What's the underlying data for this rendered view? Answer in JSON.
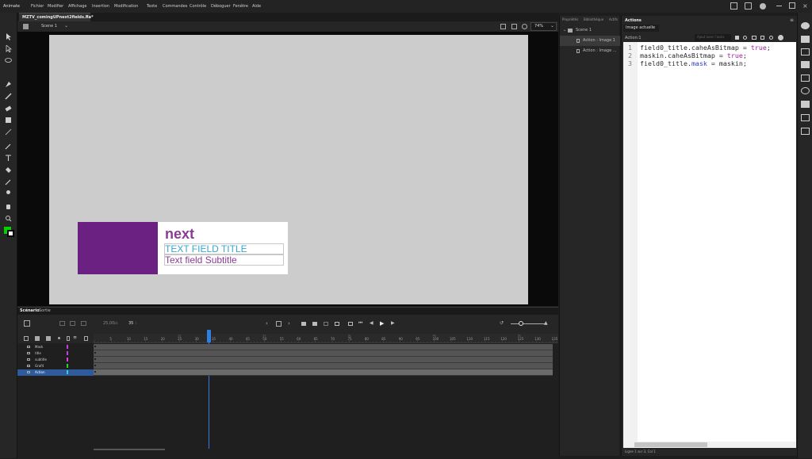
{
  "app": {
    "name": "Animate"
  },
  "menu": [
    "Fichier",
    "Modifier",
    "Affichage",
    "Insertion",
    "Modification",
    "Texte",
    "Commandes",
    "Contrôle",
    "Déboguer",
    "Fenêtre",
    "Aide"
  ],
  "document": {
    "tab": "MZTV_comingUPnext2fields.fla*",
    "scene": "Scene 1",
    "zoom": "74%"
  },
  "stage": {
    "banner_next": "next",
    "banner_title": "TEXT FIELD TITLE",
    "banner_subtitle": "Text field Subtitle"
  },
  "timeline": {
    "tabs": [
      "Scénario",
      "Sortie"
    ],
    "fps": "25,00",
    "fps_unit": "i/s",
    "frame": "35",
    "frame_unit": "i",
    "layers": [
      "Mask",
      "title",
      "subtitle",
      "Graf4",
      "Action"
    ],
    "ruler_numbers": [
      "5",
      "10",
      "15",
      "20",
      "25",
      "30",
      "35",
      "40",
      "45",
      "50",
      "55",
      "60",
      "65",
      "70",
      "75",
      "80",
      "85",
      "90",
      "95",
      "100",
      "105",
      "110",
      "115",
      "120",
      "125",
      "130",
      "135"
    ],
    "ruler_seconds": [
      "1s",
      "2s",
      "3s",
      "4s",
      "5s"
    ]
  },
  "scene_panel": {
    "tabs": [
      "Propriétés",
      "Bibliothèque",
      "Actifs"
    ],
    "root": "Scene 1",
    "items": [
      "Action : Image 1",
      "Action : Image ..."
    ]
  },
  "actions_panel": {
    "title": "Actions",
    "current_image_btn": "Image actuelle",
    "breadcrumb": "Action:1",
    "search_placeholder": "Ajout avec l'assis",
    "code_lines": [
      [
        "field0_title.caheAsBitmap = ",
        "true",
        ";"
      ],
      [
        "maskin.caheAsBitmap = ",
        "true",
        ";"
      ],
      [
        "field0_title.",
        "mask",
        " = maskin;"
      ]
    ],
    "status": "Ligne 1 sur 3, Col 1"
  },
  "colors": {
    "accent_blue": "#2d80e0",
    "banner_purple": "#6b2182",
    "title_cyan": "#36a7d0",
    "fill_color": "#00d200"
  }
}
